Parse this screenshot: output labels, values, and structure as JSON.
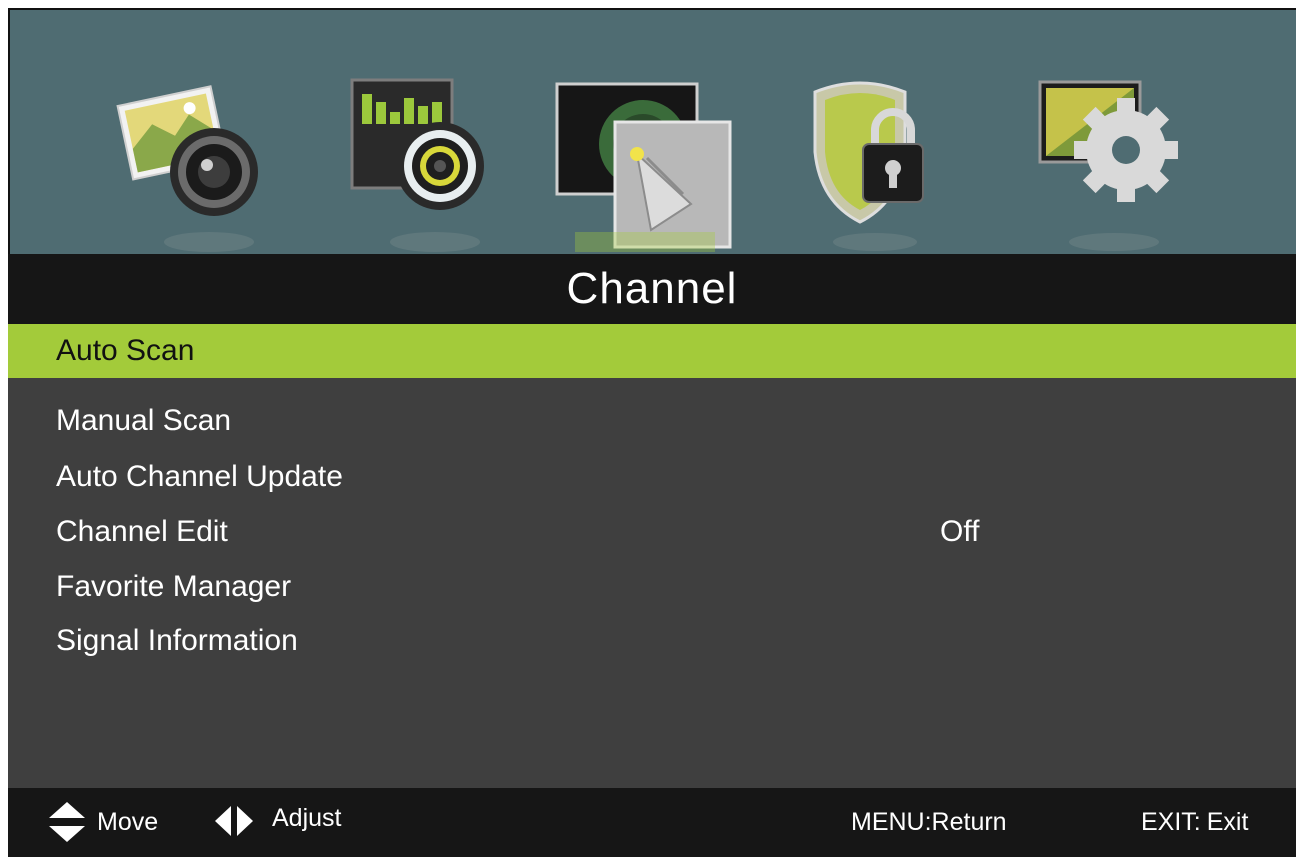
{
  "menu_tabs": [
    {
      "icon": "picture-icon",
      "selected": false
    },
    {
      "icon": "sound-icon",
      "selected": false
    },
    {
      "icon": "channel-icon",
      "selected": true
    },
    {
      "icon": "lock-icon",
      "selected": false
    },
    {
      "icon": "setup-icon",
      "selected": false
    }
  ],
  "page_title": "Channel",
  "menu_items": [
    {
      "label": "Auto Scan",
      "value": "",
      "selected": true
    },
    {
      "label": "Manual Scan",
      "value": "",
      "selected": false
    },
    {
      "label": "Auto Channel Update",
      "value": "",
      "selected": false
    },
    {
      "label": "Channel Edit",
      "value": "Off",
      "selected": false
    },
    {
      "label": "Favorite Manager",
      "value": "",
      "selected": false
    },
    {
      "label": "Signal Information",
      "value": "",
      "selected": false
    }
  ],
  "help_bar": {
    "move_label": "Move",
    "adjust_label": "Adjust",
    "menu_return": "MENU:Return",
    "exit_label": "EXIT:",
    "exit_value": "Exit"
  },
  "colors": {
    "icon_bar_bg": "#4f6c72",
    "title_bar_bg": "#161616",
    "menu_bg": "#3f3f3f",
    "selection": "#a3cb3a"
  }
}
